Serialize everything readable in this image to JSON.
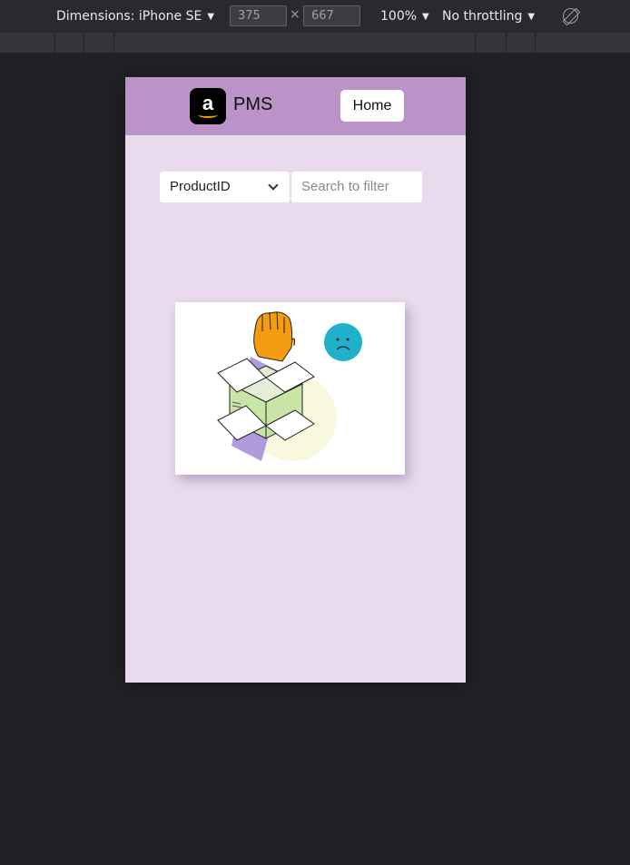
{
  "devtools": {
    "dimensions_label": "Dimensions: iPhone SE",
    "width_value": "375",
    "height_value": "667",
    "times_symbol": "×",
    "zoom": "100%",
    "throttling": "No throttling"
  },
  "app": {
    "logo_letter": "a",
    "brand": "PMS",
    "home_label": "Home",
    "filter_select": {
      "selected": "ProductID"
    },
    "search": {
      "placeholder": "Search to filter"
    }
  },
  "colors": {
    "navbar": "#bc93c8",
    "page_bg": "#e9dbed",
    "emoji": "#1fb1c9",
    "hand": "#f39c12",
    "box_green": "#c9e4a7",
    "sleeve": "#b19ad9"
  },
  "illustration": {
    "name": "empty-box-illustration",
    "icons": [
      "sad-face-icon",
      "hand-icon",
      "open-box-icon"
    ]
  }
}
